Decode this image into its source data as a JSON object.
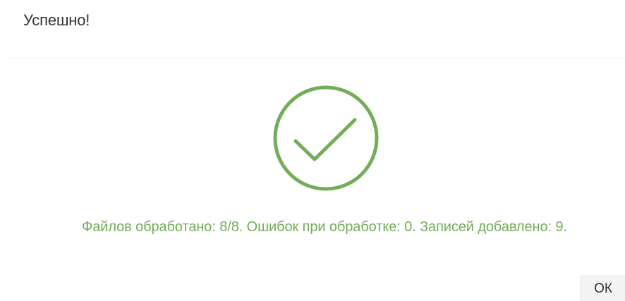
{
  "dialog": {
    "title": "Успешно!",
    "message": "Файлов обработано: 8/8. Ошибок при обработке: 0. Записей добавлено: 9.",
    "ok_label": "ОК",
    "status_icon": "checkmark-circle-icon"
  },
  "colors": {
    "success": "#72ad58",
    "title_text": "#333333",
    "divider": "#ececec",
    "button_bg": "#f4f4f4"
  }
}
